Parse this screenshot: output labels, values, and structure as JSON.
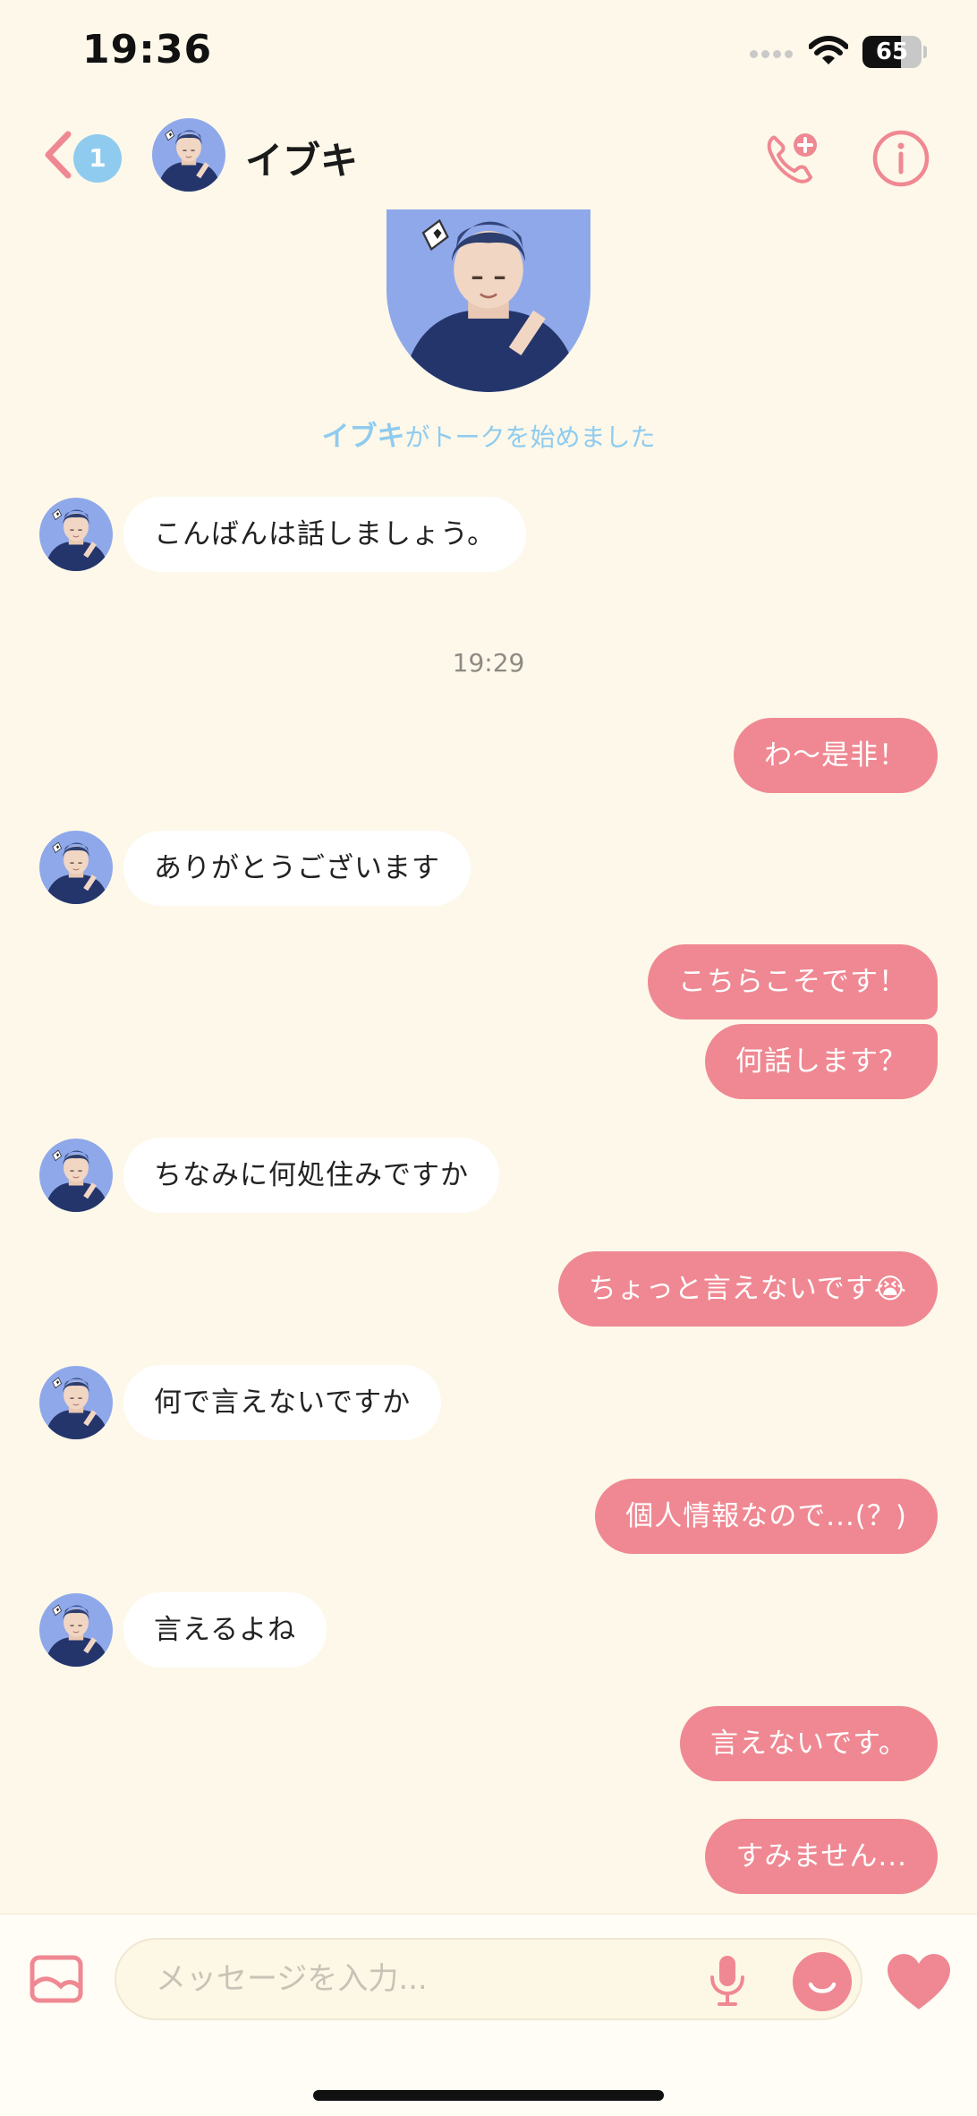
{
  "status_bar": {
    "time": "19:36",
    "battery": "65",
    "battery_level": 0.65
  },
  "header": {
    "unread_count": "1",
    "contact_name": "イブキ"
  },
  "intro": {
    "name": "イブキ",
    "text": "がトークを始めました"
  },
  "messages": [
    {
      "side": "in",
      "text": "こんばんは話しましょう。"
    },
    {
      "timestamp": "19:29"
    },
    {
      "side": "out",
      "text": "わ～是非！"
    },
    {
      "side": "in",
      "text": "ありがとうございます"
    },
    {
      "side": "out",
      "text": "こちらこそです！"
    },
    {
      "side": "out",
      "text": "何話します？"
    },
    {
      "side": "in",
      "text": "ちなみに何処住みですか"
    },
    {
      "side": "out",
      "text": "ちょっと言えないです😭"
    },
    {
      "side": "in",
      "text": "何で言えないですか"
    },
    {
      "side": "out",
      "text": "個人情報なので...(？)"
    },
    {
      "side": "in",
      "text": "言えるよね"
    },
    {
      "side": "out",
      "text": "言えないです。"
    },
    {
      "side": "out",
      "text": "すみません..."
    }
  ],
  "input": {
    "placeholder": "メッセージを入力..."
  },
  "colors": {
    "background": "#fdf8e9",
    "accent_pink": "#ef8892",
    "accent_blue": "#8fcbef"
  },
  "icons": [
    "back-icon",
    "phone-add-icon",
    "info-icon",
    "image-icon",
    "mic-icon",
    "emoji-icon",
    "heart-icon"
  ]
}
